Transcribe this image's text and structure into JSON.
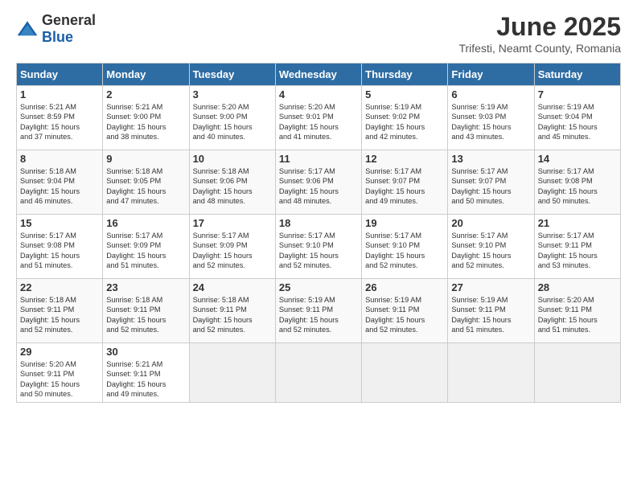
{
  "header": {
    "logo_general": "General",
    "logo_blue": "Blue",
    "title": "June 2025",
    "subtitle": "Trifesti, Neamt County, Romania"
  },
  "calendar": {
    "headers": [
      "Sunday",
      "Monday",
      "Tuesday",
      "Wednesday",
      "Thursday",
      "Friday",
      "Saturday"
    ],
    "weeks": [
      [
        {
          "day": "",
          "text": ""
        },
        {
          "day": "2",
          "text": "Sunrise: 5:21 AM\nSunset: 9:00 PM\nDaylight: 15 hours\nand 38 minutes."
        },
        {
          "day": "3",
          "text": "Sunrise: 5:20 AM\nSunset: 9:00 PM\nDaylight: 15 hours\nand 40 minutes."
        },
        {
          "day": "4",
          "text": "Sunrise: 5:20 AM\nSunset: 9:01 PM\nDaylight: 15 hours\nand 41 minutes."
        },
        {
          "day": "5",
          "text": "Sunrise: 5:19 AM\nSunset: 9:02 PM\nDaylight: 15 hours\nand 42 minutes."
        },
        {
          "day": "6",
          "text": "Sunrise: 5:19 AM\nSunset: 9:03 PM\nDaylight: 15 hours\nand 43 minutes."
        },
        {
          "day": "7",
          "text": "Sunrise: 5:19 AM\nSunset: 9:04 PM\nDaylight: 15 hours\nand 45 minutes."
        }
      ],
      [
        {
          "day": "1",
          "text": "Sunrise: 5:21 AM\nSunset: 8:59 PM\nDaylight: 15 hours\nand 37 minutes."
        },
        {
          "day": "9",
          "text": "Sunrise: 5:18 AM\nSunset: 9:05 PM\nDaylight: 15 hours\nand 47 minutes."
        },
        {
          "day": "10",
          "text": "Sunrise: 5:18 AM\nSunset: 9:06 PM\nDaylight: 15 hours\nand 48 minutes."
        },
        {
          "day": "11",
          "text": "Sunrise: 5:17 AM\nSunset: 9:06 PM\nDaylight: 15 hours\nand 48 minutes."
        },
        {
          "day": "12",
          "text": "Sunrise: 5:17 AM\nSunset: 9:07 PM\nDaylight: 15 hours\nand 49 minutes."
        },
        {
          "day": "13",
          "text": "Sunrise: 5:17 AM\nSunset: 9:07 PM\nDaylight: 15 hours\nand 50 minutes."
        },
        {
          "day": "14",
          "text": "Sunrise: 5:17 AM\nSunset: 9:08 PM\nDaylight: 15 hours\nand 50 minutes."
        }
      ],
      [
        {
          "day": "8",
          "text": "Sunrise: 5:18 AM\nSunset: 9:04 PM\nDaylight: 15 hours\nand 46 minutes."
        },
        {
          "day": "16",
          "text": "Sunrise: 5:17 AM\nSunset: 9:09 PM\nDaylight: 15 hours\nand 51 minutes."
        },
        {
          "day": "17",
          "text": "Sunrise: 5:17 AM\nSunset: 9:09 PM\nDaylight: 15 hours\nand 52 minutes."
        },
        {
          "day": "18",
          "text": "Sunrise: 5:17 AM\nSunset: 9:10 PM\nDaylight: 15 hours\nand 52 minutes."
        },
        {
          "day": "19",
          "text": "Sunrise: 5:17 AM\nSunset: 9:10 PM\nDaylight: 15 hours\nand 52 minutes."
        },
        {
          "day": "20",
          "text": "Sunrise: 5:17 AM\nSunset: 9:10 PM\nDaylight: 15 hours\nand 52 minutes."
        },
        {
          "day": "21",
          "text": "Sunrise: 5:17 AM\nSunset: 9:11 PM\nDaylight: 15 hours\nand 53 minutes."
        }
      ],
      [
        {
          "day": "15",
          "text": "Sunrise: 5:17 AM\nSunset: 9:08 PM\nDaylight: 15 hours\nand 51 minutes."
        },
        {
          "day": "23",
          "text": "Sunrise: 5:18 AM\nSunset: 9:11 PM\nDaylight: 15 hours\nand 52 minutes."
        },
        {
          "day": "24",
          "text": "Sunrise: 5:18 AM\nSunset: 9:11 PM\nDaylight: 15 hours\nand 52 minutes."
        },
        {
          "day": "25",
          "text": "Sunrise: 5:19 AM\nSunset: 9:11 PM\nDaylight: 15 hours\nand 52 minutes."
        },
        {
          "day": "26",
          "text": "Sunrise: 5:19 AM\nSunset: 9:11 PM\nDaylight: 15 hours\nand 52 minutes."
        },
        {
          "day": "27",
          "text": "Sunrise: 5:19 AM\nSunset: 9:11 PM\nDaylight: 15 hours\nand 51 minutes."
        },
        {
          "day": "28",
          "text": "Sunrise: 5:20 AM\nSunset: 9:11 PM\nDaylight: 15 hours\nand 51 minutes."
        }
      ],
      [
        {
          "day": "22",
          "text": "Sunrise: 5:18 AM\nSunset: 9:11 PM\nDaylight: 15 hours\nand 52 minutes."
        },
        {
          "day": "30",
          "text": "Sunrise: 5:21 AM\nSunset: 9:11 PM\nDaylight: 15 hours\nand 49 minutes."
        },
        {
          "day": "",
          "text": ""
        },
        {
          "day": "",
          "text": ""
        },
        {
          "day": "",
          "text": ""
        },
        {
          "day": "",
          "text": ""
        },
        {
          "day": ""
        }
      ],
      [
        {
          "day": "29",
          "text": "Sunrise: 5:20 AM\nSunset: 9:11 PM\nDaylight: 15 hours\nand 50 minutes."
        },
        {
          "day": "",
          "text": ""
        },
        {
          "day": "",
          "text": ""
        },
        {
          "day": "",
          "text": ""
        },
        {
          "day": "",
          "text": ""
        },
        {
          "day": "",
          "text": ""
        },
        {
          "day": "",
          "text": ""
        }
      ]
    ]
  }
}
